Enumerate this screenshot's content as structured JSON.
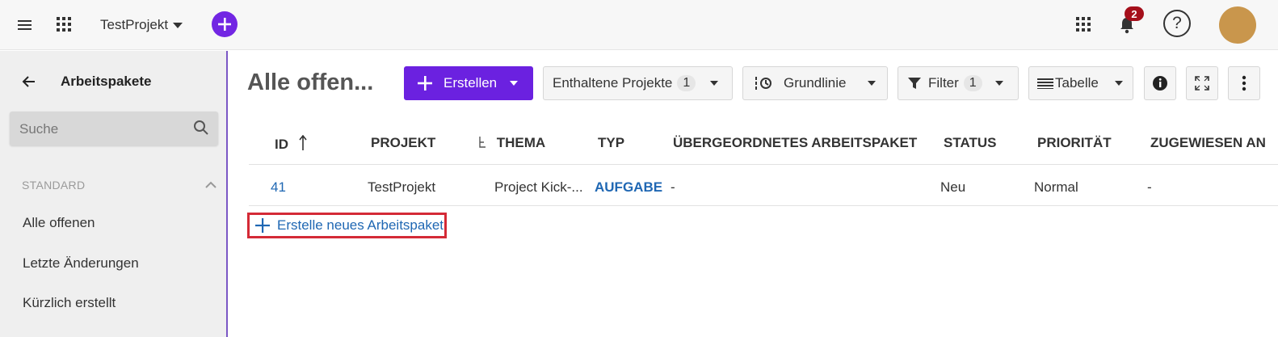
{
  "header": {
    "project_name": "TestProjekt",
    "notification_count": "2",
    "help_label": "?"
  },
  "sidebar": {
    "title": "Arbeitspakete",
    "search_placeholder": "Suche",
    "section_label": "STANDARD",
    "items": [
      {
        "label": "Alle offenen"
      },
      {
        "label": "Letzte Änderungen"
      },
      {
        "label": "Kürzlich erstellt"
      }
    ]
  },
  "toolbar": {
    "page_title": "Alle offen...",
    "create_label": "Erstellen",
    "included_projects_label": "Enthaltene Projekte",
    "included_projects_count": "1",
    "baseline_label": "Grundlinie",
    "filter_label": "Filter",
    "filter_count": "1",
    "view_label": "Tabelle"
  },
  "table": {
    "columns": [
      "ID",
      "PROJEKT",
      "THEMA",
      "TYP",
      "ÜBERGEORDNETES ARBEITSPAKET",
      "STATUS",
      "PRIORITÄT",
      "ZUGEWIESEN AN"
    ],
    "rows": [
      {
        "id": "41",
        "project": "TestProjekt",
        "subject": "Project Kick-...",
        "type": "AUFGABE",
        "parent": "-",
        "status": "Neu",
        "priority": "Normal",
        "assignee": "-"
      }
    ],
    "create_new_label": "Erstelle neues Arbeitspaket"
  },
  "colors": {
    "accent": "#6b21e0",
    "type_color": "#1f67b3",
    "highlight_border": "#d42a36",
    "badge": "#a50f1b",
    "avatar": "#c9964c"
  }
}
